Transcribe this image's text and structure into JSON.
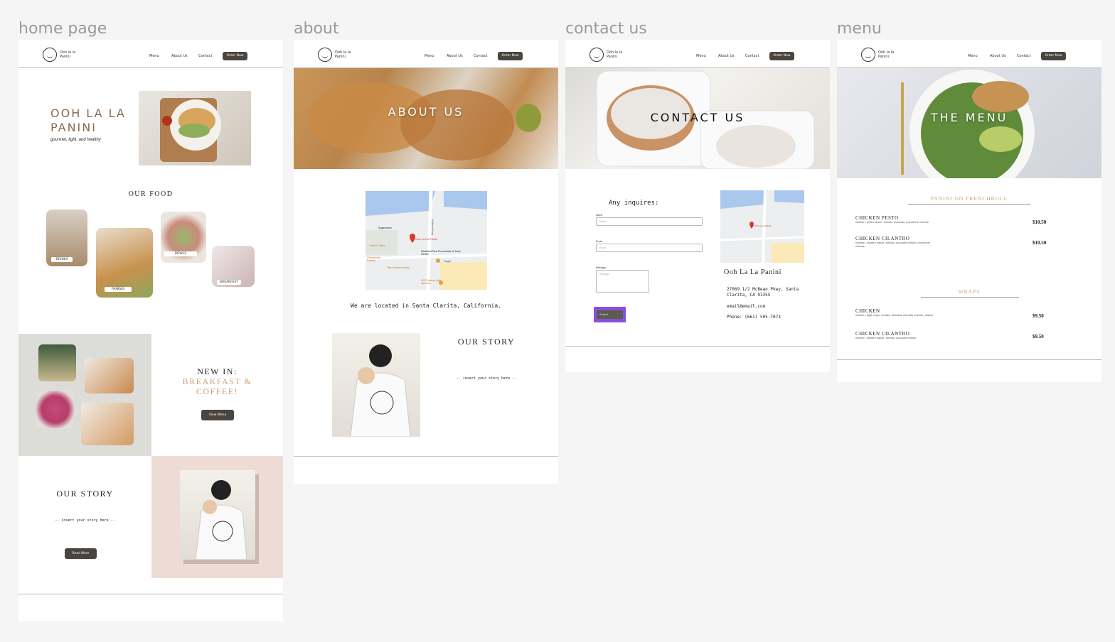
{
  "frames": {
    "home": "home page",
    "about": "about",
    "contact": "contact us",
    "menu": "menu"
  },
  "nav": {
    "logo_text": "Ooh la la Panini",
    "menu": "Menu",
    "about": "About Us",
    "contact": "Contact",
    "order": "Order Now"
  },
  "home": {
    "brand_title": "OOH LA LA PANINI",
    "tagline": "gourmet, light, and healthy",
    "our_food": "OUR FOOD",
    "food_tags": [
      "DRINKS",
      "PANINIS",
      "BOWLS",
      "BREAKFAST"
    ],
    "new_in_line1": "NEW IN:",
    "new_in_line2": "BREAKFAST &",
    "new_in_line3": "COFFEE!",
    "view_menu": "View Menu",
    "our_story": "OUR STORY",
    "story_placeholder": "-- insert your story here --",
    "read_more": "Read More"
  },
  "about": {
    "hero": "ABOUT US",
    "location": "We are located in Santa Clarita, California.",
    "our_story": "OUR STORY",
    "story_placeholder": "-- insert your story here --",
    "map_labels": [
      "Sugarmoon",
      "Ooh La La Panini",
      "Peet's Coffee",
      "Westfield Pine Promenade at Town Center",
      "Target",
      "Olive Garden Italian",
      "Cheesecake Factory",
      "SSC Bakery Cafe - Valencia",
      "McBean Pkwy"
    ]
  },
  "contact": {
    "hero": "CONTACT US",
    "inquiries": "Any inquires:",
    "name_label": "Name",
    "name_placeholder": "Name",
    "email_label": "Email",
    "email_placeholder": "Email",
    "message_label": "Message",
    "message_placeholder": "Message",
    "submit": "Submit",
    "business_name": "Ooh La La Panini",
    "address": "27069 1/2 McBean Pkwy, Santa Clarita, CA 91355",
    "email": "email@email.com",
    "phone": "Phone: (661) 505-7073"
  },
  "menu": {
    "hero": "THE MENU",
    "section1": "PANINI ON FRENCHROLL",
    "items1": [
      {
        "name": "CHICKEN PESTO",
        "desc": "chicken, pesto sauce, tomato, avocado, provolone cheese",
        "price": "$10.50"
      },
      {
        "name": "CHICKEN CILANTRO",
        "desc": "chicken, cilantro sauce, tomato, avocado lettuce, provolone cheese",
        "price": "$10.50"
      }
    ],
    "section2": "WRAPS",
    "items2": [
      {
        "name": "CHICKEN",
        "desc": "chicken, light mayo, tomato, avocado cheddar cheese, lettuce",
        "price": "$9.50"
      },
      {
        "name": "CHICKEN CILANTRO",
        "desc": "chicken, cilantro sauce, tomato, avocado lettuce",
        "price": "$9.50"
      }
    ]
  },
  "colors": {
    "accent_brown": "#8a6a4f",
    "accent_gold": "#c8a27a",
    "dark_button": "#4a4540",
    "submit_highlight": "#8b4ee0"
  }
}
